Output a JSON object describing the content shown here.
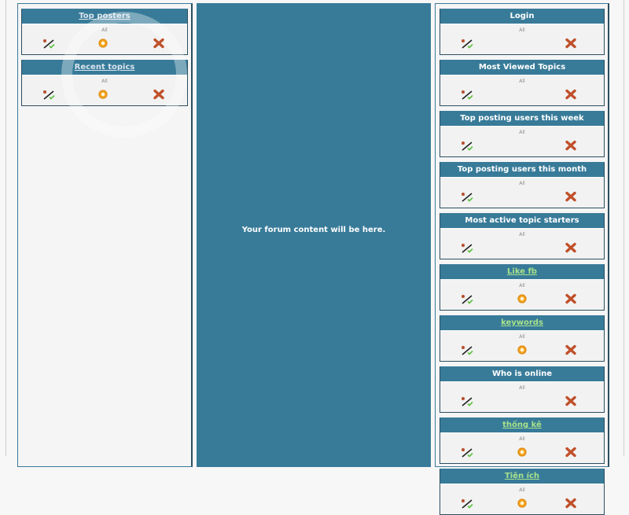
{
  "center": {
    "text": "Your forum content will be here."
  },
  "left_column": {
    "widgets": [
      {
        "title": "Top posters",
        "style": "link",
        "visibility": "All",
        "icons": [
          "move-icon",
          "settings-icon",
          "delete-icon"
        ]
      },
      {
        "title": "Recent topics",
        "style": "link",
        "visibility": "All",
        "icons": [
          "move-icon",
          "settings-icon",
          "delete-icon"
        ]
      }
    ]
  },
  "right_column": {
    "widgets": [
      {
        "title": "Login",
        "style": "plain",
        "visibility": "All",
        "icons": [
          "move-icon",
          "delete-icon"
        ]
      },
      {
        "title": "Most Viewed Topics",
        "style": "plain",
        "visibility": "All",
        "icons": [
          "move-icon",
          "delete-icon"
        ]
      },
      {
        "title": "Top posting users this week",
        "style": "plain",
        "visibility": "All",
        "icons": [
          "move-icon",
          "delete-icon"
        ]
      },
      {
        "title": "Top posting users this month",
        "style": "plain",
        "visibility": "All",
        "icons": [
          "move-icon",
          "delete-icon"
        ]
      },
      {
        "title": "Most active topic starters",
        "style": "plain",
        "visibility": "All",
        "icons": [
          "move-icon",
          "delete-icon"
        ]
      },
      {
        "title": "Like fb",
        "style": "green",
        "visibility": "All",
        "icons": [
          "move-icon",
          "settings-icon",
          "delete-icon"
        ]
      },
      {
        "title": "keywords",
        "style": "green",
        "visibility": "All",
        "icons": [
          "move-icon",
          "settings-icon",
          "delete-icon"
        ]
      },
      {
        "title": "Who is online",
        "style": "plain",
        "visibility": "All",
        "icons": [
          "move-icon",
          "delete-icon"
        ]
      },
      {
        "title": "thống kê",
        "style": "green",
        "visibility": "All",
        "icons": [
          "move-icon",
          "settings-icon",
          "delete-icon"
        ]
      },
      {
        "title": "Tiện ích",
        "style": "green",
        "visibility": "All",
        "icons": [
          "move-icon",
          "settings-icon",
          "delete-icon"
        ]
      }
    ]
  },
  "colors": {
    "header_bg": "#387b99",
    "green_link": "#a8e28a",
    "delete": "#c0502a",
    "gear": "#f0a020"
  }
}
